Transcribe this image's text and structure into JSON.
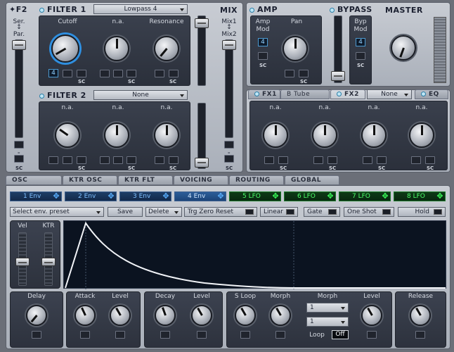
{
  "filters_section": {
    "f2": "F2",
    "ser": "Ser.",
    "par": "Par."
  },
  "filter1": {
    "title": "FILTER 1",
    "type": "Lowpass 4",
    "knobs": [
      "Cutoff",
      "n.a.",
      "Resonance"
    ],
    "value": "4"
  },
  "filter2": {
    "title": "FILTER 2",
    "type": "None",
    "knobs": [
      "n.a.",
      "n.a.",
      "n.a."
    ]
  },
  "mix": {
    "title": "MIX",
    "mix1": "Mix1",
    "mix2": "Mix2"
  },
  "amp": {
    "title": "AMP",
    "knobs": [
      "Amp Mod",
      "Pan"
    ],
    "value": "4"
  },
  "bypass": {
    "title": "BYPASS",
    "label": "Byp Mod",
    "value": "4"
  },
  "master": {
    "title": "MASTER"
  },
  "fx": {
    "tab1": "FX1",
    "fx1_value": "B Tube",
    "tab2": "FX2",
    "fx2_value": "None",
    "tab3": "EQ",
    "knobs": [
      "n.a.",
      "n.a.",
      "n.a.",
      "n.a."
    ]
  },
  "sc": "SC",
  "dash": "–",
  "mod_tabs": [
    "OSC",
    "KTR OSC",
    "KTR FLT",
    "VOICING",
    "ROUTING",
    "GLOBAL"
  ],
  "env_buttons": [
    "1 Env",
    "2 Env",
    "3 Env",
    "4 Env"
  ],
  "lfo_buttons": [
    "5 LFO",
    "6 LFO",
    "7 LFO",
    "8 LFO"
  ],
  "toolbar": {
    "preset": "Select env. preset",
    "save": "Save",
    "delete": "Delete",
    "trg_zero": "Trg Zero Reset",
    "linear": "Linear",
    "gate": "Gate",
    "one_shot": "One Shot",
    "hold": "Hold"
  },
  "sliders": {
    "vel": "Vel",
    "ktr": "KTR"
  },
  "env_knobs": {
    "delay": "Delay",
    "attack": "Attack",
    "level1": "Level",
    "decay": "Decay",
    "level2": "Level",
    "sloop": "S Loop",
    "morph1": "Morph",
    "morph2": "Morph",
    "level3": "Level",
    "release": "Release"
  },
  "morph_selects": [
    "1",
    "1"
  ],
  "loop": {
    "label": "Loop",
    "value": "Off"
  }
}
